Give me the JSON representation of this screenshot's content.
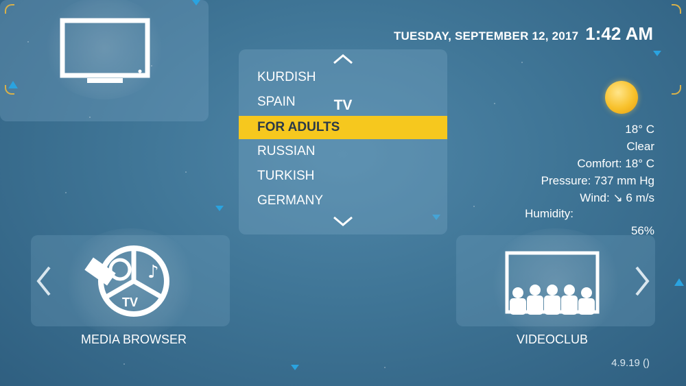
{
  "header": {
    "date": "TUESDAY, SEPTEMBER 12, 2017",
    "time": "1:42 AM"
  },
  "category_list": {
    "items": [
      {
        "label": "KURDISH",
        "selected": false
      },
      {
        "label": "SPAIN",
        "selected": false
      },
      {
        "label": "FOR ADULTS",
        "selected": true
      },
      {
        "label": "RUSSIAN",
        "selected": false
      },
      {
        "label": "TURKISH",
        "selected": false
      },
      {
        "label": "GERMANY",
        "selected": false
      }
    ],
    "scroll_up_icon": "chevron-up-icon",
    "scroll_down_icon": "chevron-down-icon"
  },
  "weather": {
    "icon": "sun-icon",
    "temperature": "18° C",
    "condition": "Clear",
    "comfort": "Comfort: 18° C",
    "pressure": "Pressure: 737 mm Hg",
    "wind": "Wind: ↘ 6 m/s",
    "humidity_label": "Humidity:",
    "humidity_value": "56%"
  },
  "menu": {
    "items": [
      {
        "label": "MEDIA BROWSER",
        "icon": "media-browser-icon"
      },
      {
        "label": "TV",
        "icon": "tv-icon",
        "selected": true
      },
      {
        "label": "VIDEOCLUB",
        "icon": "videoclub-icon"
      }
    ],
    "prev_icon": "chevron-left-icon",
    "next_icon": "chevron-right-icon"
  },
  "footer": {
    "version": "4.9.19 ()"
  },
  "colors": {
    "background": "#3f7596",
    "highlight": "#f6c81e",
    "accent_triangle": "#2aa3e0"
  }
}
